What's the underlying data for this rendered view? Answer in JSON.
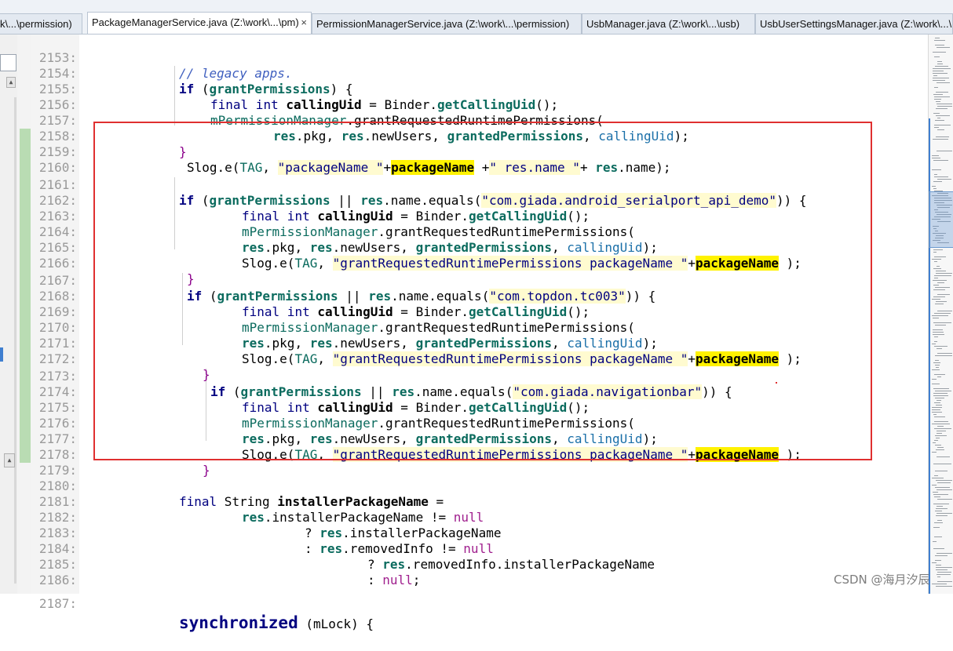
{
  "tabs": [
    {
      "label": "k\\...\\permission)",
      "active": false
    },
    {
      "label": "PackageManagerService.java (Z:\\work\\...\\pm)",
      "active": true,
      "close": "×"
    },
    {
      "label": "PermissionManagerService.java (Z:\\work\\...\\permission)",
      "active": false
    },
    {
      "label": "UsbManager.java (Z:\\work\\...\\usb)",
      "active": false
    },
    {
      "label": "UsbUserSettingsManager.java (Z:\\work\\...\\usb)",
      "active": false
    }
  ],
  "line_numbers": [
    "2153:",
    "2154:",
    "2155:",
    "2156:",
    "2157:",
    "2158:",
    "2159:",
    "2160:",
    "2161:",
    "2162:",
    "2163:",
    "2164:",
    "2165:",
    "2166:",
    "2167:",
    "2168:",
    "2169:",
    "2170:",
    "2171:",
    "2172:",
    "2173:",
    "2174:",
    "2175:",
    "2176:",
    "2177:",
    "2178:",
    "2179:",
    "2180:",
    "2181:",
    "2182:",
    "2183:",
    "2184:",
    "2185:",
    "2186:",
    "2187:"
  ],
  "code": {
    "l2153": {
      "text": "// legacy apps."
    },
    "l2154": {
      "kw": "if",
      "open": " (",
      "var": "grantPermissions",
      "close": ") {"
    },
    "l2155": {
      "final": "final",
      "int": " int ",
      "name": "callingUid",
      "eq": " = Binder.",
      "call": "getCallingUid",
      "end": "();"
    },
    "l2156": {
      "field": "mPermissionManager",
      "rest": ".grantRequestedRuntimePermissions("
    },
    "l2157": {
      "res1": "res",
      "a": ".pkg, ",
      "res2": "res",
      "b": ".newUsers, ",
      "gp": "grantedPermissions",
      "c": ", ",
      "cu": "callingUid",
      "d": ");"
    },
    "l2158": {
      "text": "}"
    },
    "l2159": {
      "a": "Slog.e(",
      "tag": "TAG",
      "b": ", ",
      "s1": "\"packageName \"",
      "plus": "+",
      "pn": "packageName",
      "c": " +",
      "s2": "\" res.name \"",
      "d": "+ ",
      "res": "res",
      "e": ".name);"
    },
    "l2160": {
      "text": ""
    },
    "l2161": {
      "kw": "if",
      "open": " (",
      "var": "grantPermissions",
      "or": " || ",
      "res": "res",
      "mid": ".name.equals(",
      "str": "\"com.giada.android_serialport_api_demo\"",
      "close": ")) {"
    },
    "l2162": {
      "final": "final",
      "int": " int ",
      "name": "callingUid",
      "eq": " = Binder.",
      "call": "getCallingUid",
      "end": "();"
    },
    "l2163": {
      "field": "mPermissionManager",
      "rest": ".grantRequestedRuntimePermissions("
    },
    "l2164": {
      "res1": "res",
      "a": ".pkg, ",
      "res2": "res",
      "b": ".newUsers, ",
      "gp": "grantedPermissions",
      "c": ", ",
      "cu": "callingUid",
      "d": ");"
    },
    "l2165": {
      "a": "Slog.e(",
      "tag": "TAG",
      "b": ", ",
      "s": "\"grantRequestedRuntimePermissions packageName \"",
      "plus": "+",
      "pn": "packageName",
      "d": " );"
    },
    "l2166": {
      "text": "}"
    },
    "l2167": {
      "kw": "if",
      "open": " (",
      "var": "grantPermissions",
      "or": " || ",
      "res": "res",
      "mid": ".name.equals(",
      "str": "\"com.topdon.tc003\"",
      "close": ")) {"
    },
    "l2168": {
      "final": "final",
      "int": " int ",
      "name": "callingUid",
      "eq": " = Binder.",
      "call": "getCallingUid",
      "end": "();"
    },
    "l2169": {
      "field": "mPermissionManager",
      "rest": ".grantRequestedRuntimePermissions("
    },
    "l2170": {
      "res1": "res",
      "a": ".pkg, ",
      "res2": "res",
      "b": ".newUsers, ",
      "gp": "grantedPermissions",
      "c": ", ",
      "cu": "callingUid",
      "d": ");"
    },
    "l2171": {
      "a": "Slog.e(",
      "tag": "TAG",
      "b": ", ",
      "s": "\"grantRequestedRuntimePermissions packageName \"",
      "plus": "+",
      "pn": "packageName",
      "d": " );"
    },
    "l2172": {
      "text": "}"
    },
    "l2173": {
      "kw": "if",
      "open": " (",
      "var": "grantPermissions",
      "or": " || ",
      "res": "res",
      "mid": ".name.equals(",
      "str": "\"com.giada.navigationbar\"",
      "close": ")) {"
    },
    "l2174": {
      "final": "final",
      "int": " int ",
      "name": "callingUid",
      "eq": " = Binder.",
      "call": "getCallingUid",
      "end": "();"
    },
    "l2175": {
      "field": "mPermissionManager",
      "rest": ".grantRequestedRuntimePermissions("
    },
    "l2176": {
      "res1": "res",
      "a": ".pkg, ",
      "res2": "res",
      "b": ".newUsers, ",
      "gp": "grantedPermissions",
      "c": ", ",
      "cu": "callingUid",
      "d": ");"
    },
    "l2177": {
      "a": "Slog.e(",
      "tag": "TAG",
      "b": ", ",
      "s": "\"grantRequestedRuntimePermissions packageName \"",
      "plus": "+",
      "pn": "packageName",
      "d": " );"
    },
    "l2178": {
      "text": "}"
    },
    "l2179": {
      "text": ""
    },
    "l2180": {
      "final": "final",
      "type": " String ",
      "name": "installerPackageName",
      "end": " ="
    },
    "l2181": {
      "res": "res",
      "a": ".installerPackageName != ",
      "nul": "null"
    },
    "l2182": {
      "q": "? ",
      "res": "res",
      "a": ".installerPackageName"
    },
    "l2183": {
      "q": ": ",
      "res": "res",
      "a": ".removedInfo != ",
      "nul": "null"
    },
    "l2184": {
      "q": "? ",
      "res": "res",
      "a": ".removedInfo.installerPackageName"
    },
    "l2185": {
      "q": ": ",
      "nul": "null",
      "a": ";"
    },
    "l2186": {
      "text": ""
    },
    "l2187": {
      "kw": "synchronized",
      "a": " (mLock) {"
    }
  },
  "watermark": "CSDN @海月汐辰",
  "colors": {
    "annotation_box": "#e03030",
    "highlight": "#fff200",
    "change_bar": "#b9dcb3",
    "keyword": "#000080"
  }
}
